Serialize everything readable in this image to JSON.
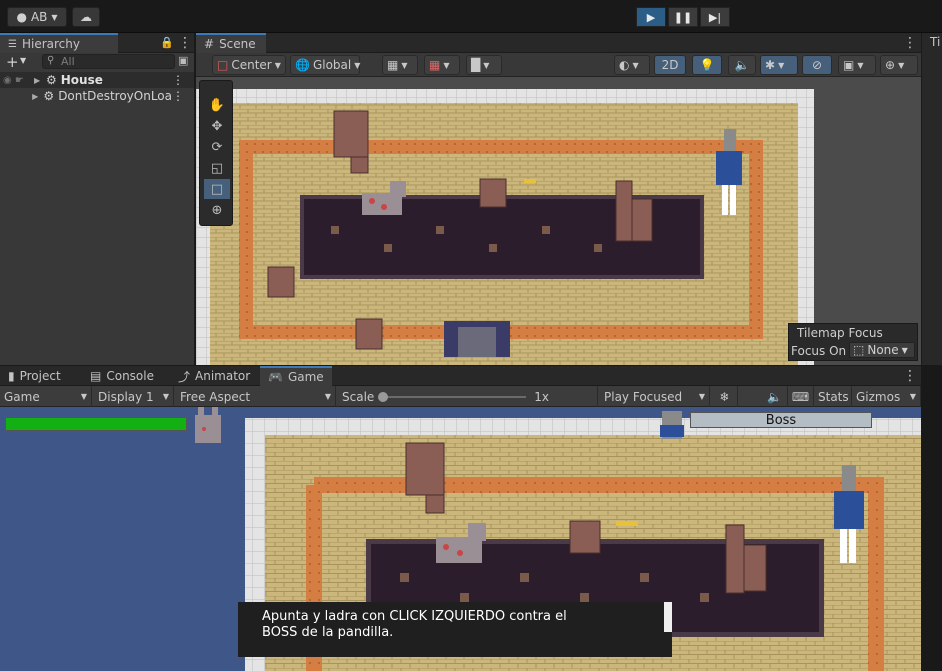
{
  "toolbar": {
    "account": "AB",
    "play_controls": [
      "play",
      "pause",
      "step"
    ]
  },
  "hierarchy": {
    "tab_label": "Hierarchy",
    "search_placeholder": "All",
    "items": [
      {
        "label": "House",
        "expanded": false,
        "bold": true
      },
      {
        "label": "DontDestroyOnLoa",
        "expanded": false,
        "bold": false
      }
    ]
  },
  "scene": {
    "tab_label": "Scene",
    "pivot": "Center",
    "space": "Global",
    "mode_2d": "2D",
    "tilemap_focus": {
      "title": "Tilemap Focus",
      "label": "Focus On",
      "value": "None"
    }
  },
  "right_tab": {
    "label": "Ti"
  },
  "bottom_tabs": [
    {
      "label": "Project",
      "icon": "folder-icon"
    },
    {
      "label": "Console",
      "icon": "console-icon"
    },
    {
      "label": "Animator",
      "icon": "animator-icon"
    },
    {
      "label": "Game",
      "icon": "gamepad-icon",
      "active": true
    }
  ],
  "game": {
    "view": "Game",
    "display": "Display 1",
    "aspect": "Free Aspect",
    "scale_label": "Scale",
    "scale_value": "1x",
    "play_mode": "Play Focused",
    "stats": "Stats",
    "gizmos": "Gizmos",
    "boss_label": "Boss",
    "player_health": 1.0,
    "dialog_line1": "Apunta y ladra con CLICK IZQUIERDO contra el",
    "dialog_line2": "BOSS de la pandilla."
  },
  "colors": {
    "accent": "#3a79bb",
    "health": "#12b012",
    "brick": "#c8b47a",
    "floor_path": "#cf7a3e",
    "pit": "#2d1f2b",
    "game_bg": "#3f5689"
  }
}
